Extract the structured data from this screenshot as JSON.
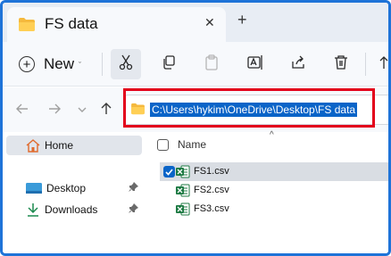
{
  "tab": {
    "title": "FS data",
    "close_glyph": "✕",
    "new_tab_glyph": "+"
  },
  "toolbar": {
    "new_label": "New",
    "new_caret": "ˇ",
    "buttons": [
      "cut-icon",
      "copy-icon",
      "paste-icon",
      "rename-icon",
      "share-icon",
      "delete-icon",
      "sort-icon"
    ]
  },
  "address": {
    "path": "C:\\Users\\hykim\\OneDrive\\Desktop\\FS data",
    "highlight_color": "#e3001b"
  },
  "sidebar": {
    "items": [
      {
        "label": "Home",
        "icon": "home-icon"
      },
      {
        "label": "Desktop",
        "icon": "desktop-icon",
        "pinned": true
      },
      {
        "label": "Downloads",
        "icon": "download-icon",
        "pinned": true
      }
    ],
    "pin_glyph": "📌"
  },
  "list": {
    "column_name": "Name",
    "sort_glyph": "^",
    "files": [
      {
        "name": "FS1.csv",
        "selected": true
      },
      {
        "name": "FS2.csv",
        "selected": false
      },
      {
        "name": "FS3.csv",
        "selected": false
      }
    ]
  },
  "colors": {
    "accent": "#0a64c8",
    "window_border": "#1e73d8",
    "excel_green": "#1d7a43"
  }
}
